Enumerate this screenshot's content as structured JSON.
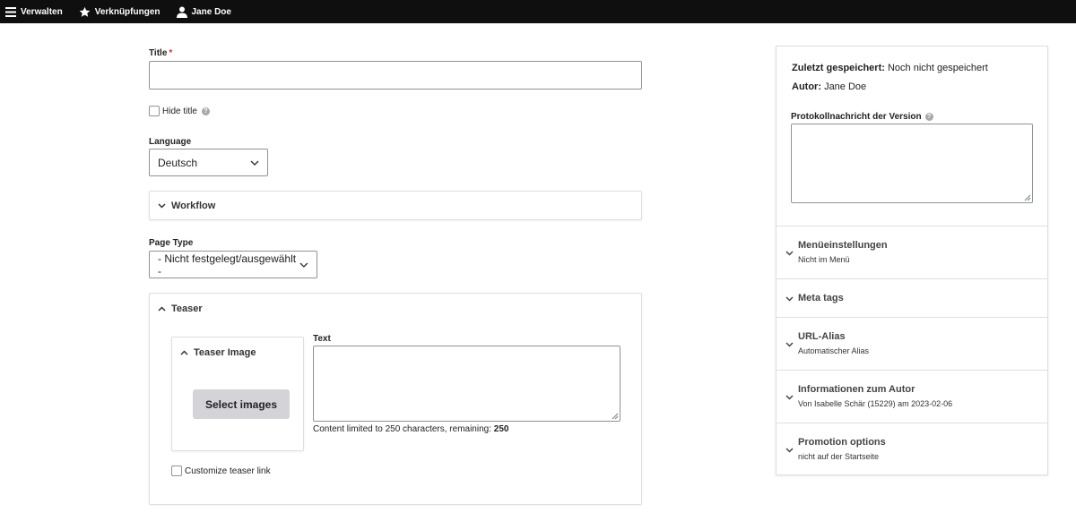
{
  "toolbar": {
    "manage": "Verwalten",
    "shortcuts": "Verknüpfungen",
    "user": "Jane Doe"
  },
  "form": {
    "title_label": "Title",
    "title_required": "*",
    "title_value": "",
    "hide_title_label": "Hide title",
    "language_label": "Language",
    "language_value": "Deutsch",
    "workflow_label": "Workflow",
    "page_type_label": "Page Type",
    "page_type_value": "- Nicht festgelegt/ausgewählt -",
    "teaser": {
      "label": "Teaser",
      "image_label": "Teaser Image",
      "select_images": "Select images",
      "text_label": "Text",
      "text_value": "",
      "limit_text": "Content limited to 250 characters, remaining: ",
      "limit_remaining": "250",
      "customize_link": "Customize teaser link"
    }
  },
  "sidebar": {
    "last_saved_label": "Zuletzt gespeichert:",
    "last_saved_value": "Noch nicht gespeichert",
    "author_label": "Autor:",
    "author_value": "Jane Doe",
    "revision_label": "Protokollnachricht der Version",
    "revision_value": "",
    "sections": [
      {
        "title": "Menüeinstellungen",
        "summary": "Nicht im Menü"
      },
      {
        "title": "Meta tags",
        "summary": ""
      },
      {
        "title": "URL-Alias",
        "summary": "Automatischer Alias"
      },
      {
        "title": "Informationen zum Autor",
        "summary": "Von Isabelle Schär (15229) am 2023-02-06"
      },
      {
        "title": "Promotion options",
        "summary": "nicht auf der Startseite"
      }
    ]
  },
  "colors": {
    "toolbar_bg": "#0f0f0f",
    "required": "#c0392b",
    "button_bg": "#d4d4d8",
    "border": "#8e929c"
  }
}
